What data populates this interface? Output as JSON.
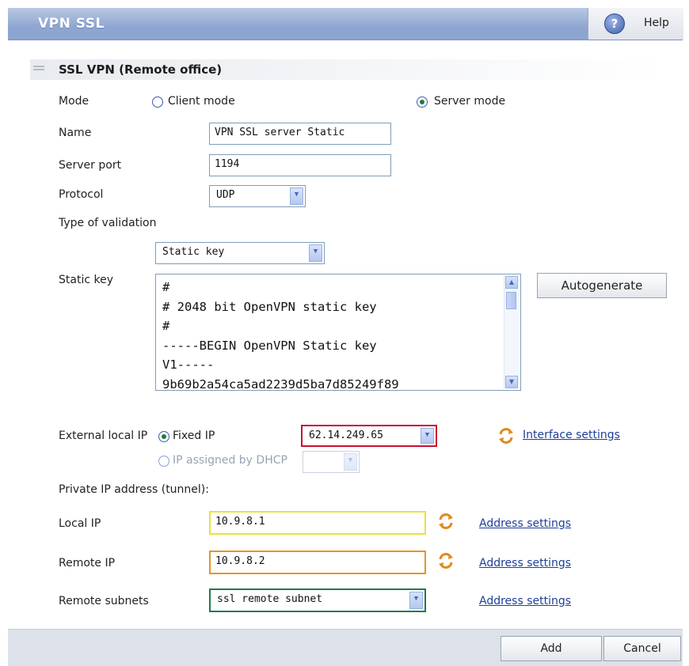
{
  "window": {
    "title": "VPN SSL",
    "help_label": "Help"
  },
  "section": {
    "title": "SSL VPN (Remote office)"
  },
  "mode": {
    "label": "Mode",
    "option_client": "Client mode",
    "option_server": "Server mode",
    "selected": "Server mode"
  },
  "name": {
    "label": "Name",
    "value": "VPN SSL server Static"
  },
  "server_port": {
    "label": "Server port",
    "value": "1194"
  },
  "protocol": {
    "label": "Protocol",
    "value": "UDP"
  },
  "validation": {
    "label": "Type of validation",
    "value": "Static key"
  },
  "static_key": {
    "label": "Static key",
    "lines": [
      "#",
      "# 2048 bit OpenVPN static key",
      "#",
      "-----BEGIN OpenVPN Static key",
      "V1-----",
      "9b69b2a54ca5ad2239d5ba7d85249f89"
    ],
    "autogenerate_label": "Autogenerate"
  },
  "external_ip": {
    "label": "External local IP",
    "option_fixed": "Fixed IP",
    "fixed_value": "62.14.249.65",
    "option_dhcp": "IP assigned by DHCP",
    "dhcp_value": "",
    "interface_link": "Interface settings",
    "fixed_border": "#c8102e"
  },
  "private": {
    "label": "Private IP address (tunnel):"
  },
  "local_ip": {
    "label": "Local IP",
    "value": "10.9.8.1",
    "border": "#e9e23a",
    "link": "Address settings"
  },
  "remote_ip": {
    "label": "Remote IP",
    "value": "10.9.8.2",
    "border": "#e3952a",
    "link": "Address settings"
  },
  "remote_subnets": {
    "label": "Remote subnets",
    "value": "ssl remote subnet",
    "border": "#1f7a4c",
    "link": "Address settings"
  },
  "footer": {
    "add_label": "Add",
    "cancel_label": "Cancel"
  },
  "icons": {
    "help": "help-icon",
    "refresh": "refresh-cycle-icon",
    "dropdown": "chevron-down-icon"
  }
}
